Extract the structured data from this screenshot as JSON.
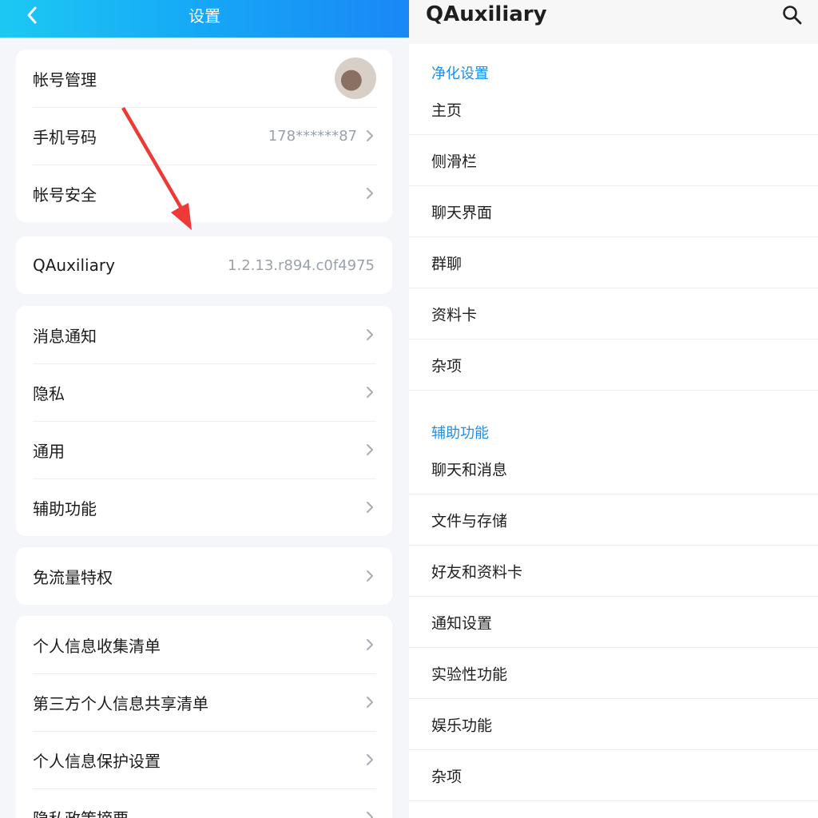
{
  "left": {
    "header": {
      "title": "设置"
    },
    "account_card": {
      "account_manage": "帐号管理",
      "phone_label": "手机号码",
      "phone_value": "178******87",
      "account_security": "帐号安全"
    },
    "module": {
      "label": "QAuxiliary",
      "version": "1.2.13.r894.c0f4975"
    },
    "group2": [
      "消息通知",
      "隐私",
      "通用",
      "辅助功能"
    ],
    "group3": [
      "免流量特权"
    ],
    "group4": [
      "个人信息收集清单",
      "第三方个人信息共享清单",
      "个人信息保护设置",
      "隐私政策摘要"
    ]
  },
  "right": {
    "header": {
      "title": "QAuxiliary"
    },
    "section1": {
      "title": "净化设置",
      "items": [
        "主页",
        "侧滑栏",
        "聊天界面",
        "群聊",
        "资料卡",
        "杂项"
      ]
    },
    "section2": {
      "title": "辅助功能",
      "items": [
        "聊天和消息",
        "文件与存储",
        "好友和资料卡",
        "通知设置",
        "实验性功能",
        "娱乐功能",
        "杂项"
      ]
    }
  },
  "icons": {
    "back": "back-arrow-icon",
    "chevron": "chevron-right-icon",
    "search": "search-icon",
    "annotation": "red-arrow-annotation"
  },
  "colors": {
    "header_gradient_start": "#1cc9f3",
    "header_gradient_end": "#1a87f6",
    "section_title": "#1f8fe8",
    "annotation_arrow": "#ee3a36"
  }
}
